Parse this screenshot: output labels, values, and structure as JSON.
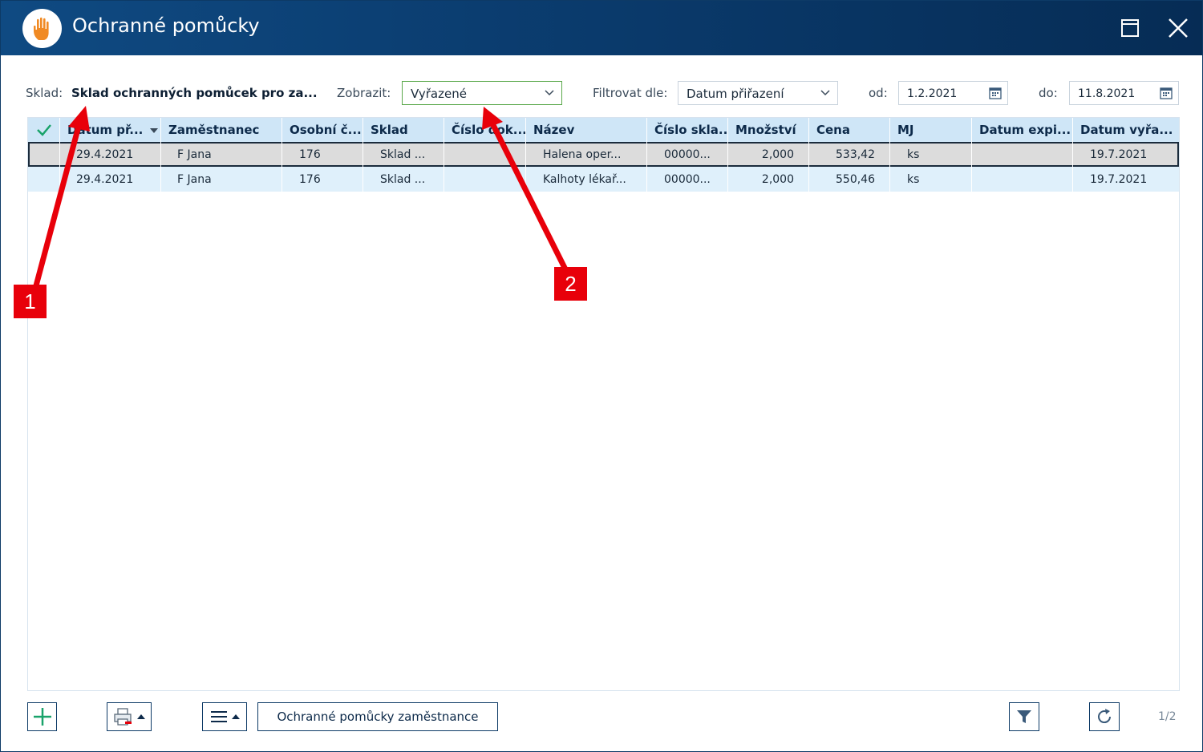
{
  "window": {
    "title": "Ochranné pomůcky"
  },
  "filters": {
    "sklad_label": "Sklad:",
    "sklad_value": "Sklad ochranných pomůcek pro za...",
    "zobrazit_label": "Zobrazit:",
    "zobrazit_value": "Vyřazené",
    "filtrovat_label": "Filtrovat dle:",
    "filtrovat_value": "Datum přiřazení",
    "od_label": "od:",
    "od_value": "1.2.2021",
    "do_label": "do:",
    "do_value": "11.8.2021"
  },
  "table": {
    "columns": [
      "Datum př...",
      "Zaměstnanec",
      "Osobní č...",
      "Sklad",
      "Číslo dok...",
      "Název",
      "Číslo skla...",
      "Množství",
      "Cena",
      "MJ",
      "Datum expi...",
      "Datum vyřa..."
    ],
    "rows": [
      [
        "29.4.2021",
        "F Jana",
        "176",
        "Sklad ...",
        "",
        "Halena oper...",
        "00000...",
        "2,000",
        "533,42",
        "ks",
        "",
        "19.7.2021"
      ],
      [
        "29.4.2021",
        "F Jana",
        "176",
        "Sklad ...",
        "",
        "Kalhoty lékař...",
        "00000...",
        "2,000",
        "550,46",
        "ks",
        "",
        "19.7.2021"
      ]
    ]
  },
  "toolbar": {
    "employee_button": "Ochranné pomůcky zaměstnance",
    "pager": "1/2"
  },
  "annotations": {
    "badge1": "1",
    "badge2": "2"
  },
  "colors": {
    "titlebar": "#0b3d70",
    "header_bg": "#cfe6f7",
    "selected_row": "#dcdcdc",
    "alt_row": "#dff0fb",
    "accent_green": "#1aa36b",
    "annotation_red": "#e8000a"
  },
  "icons": {
    "app": "hand-icon",
    "maximize": "maximize-icon",
    "close": "close-icon",
    "add": "plus-icon",
    "print": "printer-icon",
    "menu": "menu-icon",
    "filter": "filter-icon",
    "refresh": "refresh-icon"
  }
}
